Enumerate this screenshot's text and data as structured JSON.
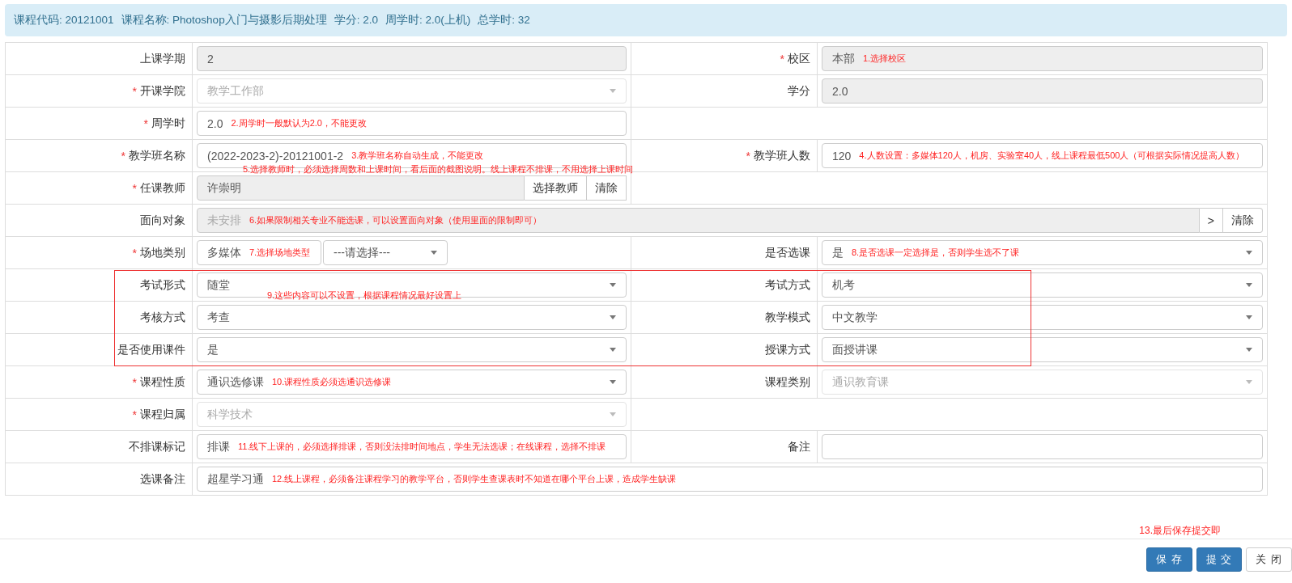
{
  "header": {
    "items": [
      "课程代码: 20121001",
      "课程名称: Photoshop入门与摄影后期处理",
      "学分: 2.0",
      "周学时: 2.0(上机)",
      "总学时: 32"
    ]
  },
  "rows": [
    {
      "highlighted": false,
      "cells": [
        {
          "label": "上课学期",
          "field": {
            "kind": "text",
            "value": "2",
            "readonly": true
          }
        },
        {
          "mark": "*",
          "label": "校区",
          "field": {
            "kind": "text",
            "value": "本部",
            "readonly": true,
            "note": "1.选择校区"
          }
        }
      ]
    },
    {
      "highlighted": false,
      "cells": [
        {
          "mark": "*",
          "label": "开课学院",
          "field": {
            "kind": "select",
            "value": "教学工作部",
            "disabled": true
          }
        },
        {
          "label": "学分",
          "field": {
            "kind": "text",
            "value": "2.0",
            "readonly": true
          }
        }
      ]
    },
    {
      "highlighted": false,
      "cells": [
        {
          "mark": "*",
          "label": "周学时",
          "field": {
            "kind": "text",
            "value": "2.0",
            "note": "2.周学时一般默认为2.0，不能更改"
          }
        }
      ]
    },
    {
      "highlighted": false,
      "cells": [
        {
          "mark": "*",
          "label": "教学班名称",
          "field": {
            "kind": "text",
            "value": "(2022-2023-2)-20121001-2",
            "note": "3.教学班名称自动生成，不能更改"
          }
        },
        {
          "mark": "*",
          "label": "教学班人数",
          "field": {
            "kind": "text",
            "value": "120",
            "note": "4.人数设置：多媒体120人，机房、实验室40人，线上课程最低500人（可根据实际情况提高人数）"
          }
        }
      ]
    },
    {
      "highlighted": false,
      "cells": [
        {
          "mark": "*",
          "label": "任课教师",
          "field": {
            "kind": "picker",
            "value": "许崇明",
            "readonly": true,
            "note_above": "5.选择教师时，必须选择周数和上课时间，看后面的截图说明。线上课程不排课，不用选择上课时间",
            "buttons": [
              "选择教师",
              "清除"
            ]
          }
        }
      ]
    },
    {
      "highlighted": false,
      "full": true,
      "cells": [
        {
          "label": "面向对象",
          "field": {
            "kind": "picker",
            "placeholder": "未安排",
            "readonly": true,
            "note": "6.如果限制相关专业不能选课，可以设置面向对象（使用里面的限制即可）",
            "buttons": [
              ">",
              "清除"
            ]
          }
        }
      ]
    },
    {
      "highlighted": false,
      "cells": [
        {
          "mark": "*",
          "label": "场地类别",
          "field": {
            "kind": "select_pair",
            "value": "多媒体",
            "note": "7.选择场地类型",
            "value_2": "---请选择---"
          }
        },
        {
          "label": "是否选课",
          "field": {
            "kind": "select",
            "value": "是",
            "note": "8.是否选课一定选择是，否则学生选不了课"
          }
        }
      ]
    },
    {
      "highlighted": true,
      "cells": [
        {
          "label": "考试形式",
          "field": {
            "kind": "select",
            "value": "随堂",
            "note_below": "9.这些内容可以不设置，根据课程情况最好设置上"
          }
        },
        {
          "label": "考试方式",
          "field": {
            "kind": "select",
            "value": "机考"
          }
        }
      ]
    },
    {
      "highlighted": true,
      "cells": [
        {
          "label": "考核方式",
          "field": {
            "kind": "select",
            "value": "考查"
          }
        },
        {
          "label": "教学模式",
          "field": {
            "kind": "select",
            "value": "中文教学"
          }
        }
      ]
    },
    {
      "highlighted": true,
      "cells": [
        {
          "label": "是否使用课件",
          "field": {
            "kind": "select",
            "value": "是"
          }
        },
        {
          "label": "授课方式",
          "field": {
            "kind": "select",
            "value": "面授讲课"
          }
        }
      ]
    },
    {
      "highlighted": false,
      "cells": [
        {
          "mark": "*",
          "label": "课程性质",
          "field": {
            "kind": "select",
            "value": "通识选修课",
            "note": "10.课程性质必须选通识选修课"
          }
        },
        {
          "label": "课程类别",
          "field": {
            "kind": "select",
            "value": "通识教育课",
            "disabled": true
          }
        }
      ]
    },
    {
      "highlighted": false,
      "cells": [
        {
          "mark": "*",
          "label": "课程归属",
          "field": {
            "kind": "select",
            "value": "科学技术",
            "disabled": true
          }
        }
      ]
    },
    {
      "highlighted": false,
      "cells": [
        {
          "label": "不排课标记",
          "field": {
            "kind": "select",
            "value": "排课",
            "note": "11.线下上课的，必须选择排课，否则没法排时间地点，学生无法选课；在线课程，选择不排课"
          }
        },
        {
          "label": "备注",
          "field": {
            "kind": "text"
          }
        }
      ]
    },
    {
      "highlighted": false,
      "full": true,
      "cells": [
        {
          "label": "选课备注",
          "field": {
            "kind": "text",
            "value": "超星学习通",
            "note": "12.线上课程，必须备注课程学习的教学平台，否则学生查课表时不知道在哪个平台上课，造成学生缺课"
          }
        }
      ]
    }
  ],
  "footer": {
    "note": "13.最后保存提交即",
    "buttons": [
      {
        "label": "保 存",
        "kind": "primary"
      },
      {
        "label": "提 交",
        "kind": "primary"
      },
      {
        "label": "关 闭",
        "kind": "default"
      }
    ]
  }
}
